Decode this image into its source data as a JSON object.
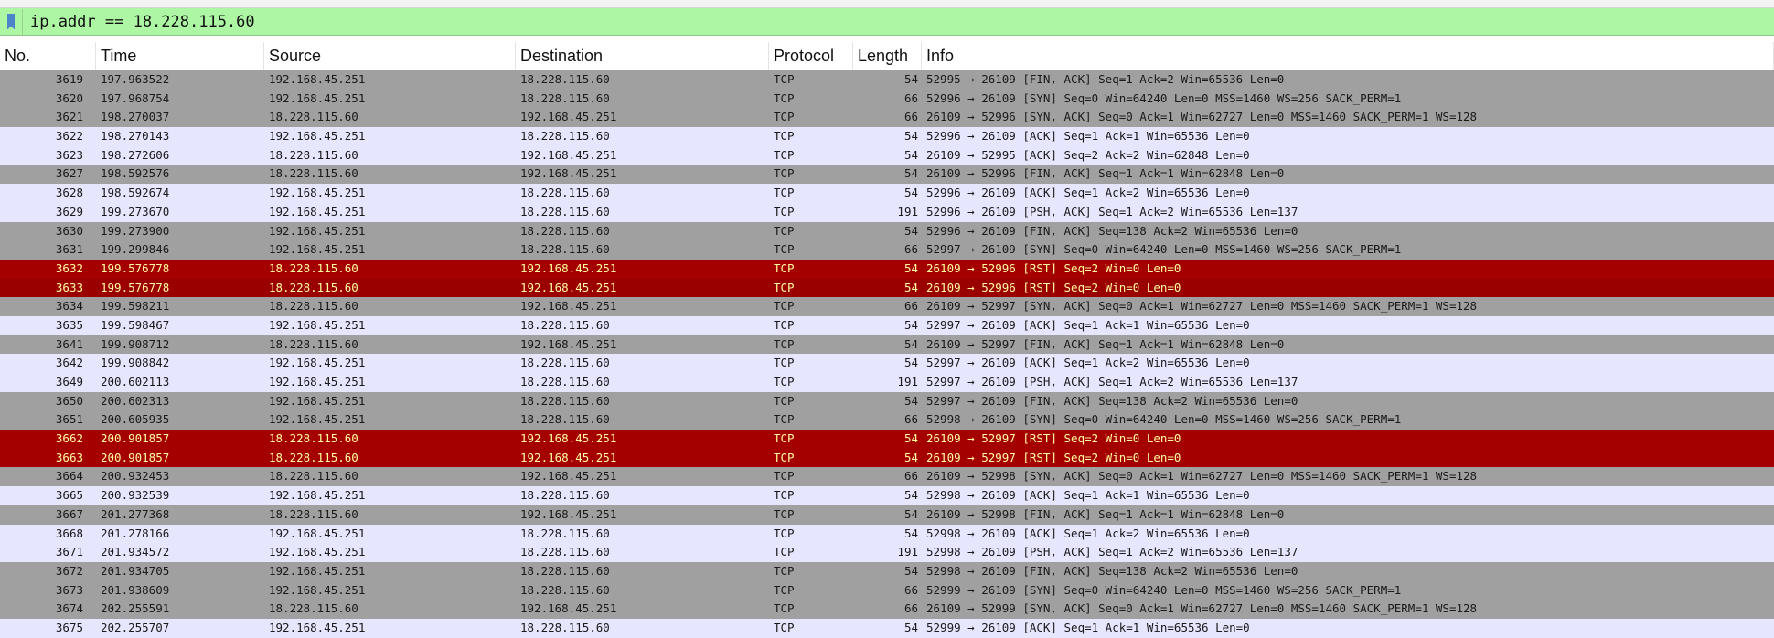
{
  "filter": {
    "value": "ip.addr == 18.228.115.60"
  },
  "columns": [
    "No.",
    "Time",
    "Source",
    "Destination",
    "Protocol",
    "Length",
    "Info"
  ],
  "colors": {
    "filter_valid": "#adf6a4",
    "row_gray": "#a0a0a0",
    "row_light": "#e7e6ff",
    "row_rst": "#a40000",
    "rst_text": "#fffc9c"
  },
  "packets": [
    {
      "no": "3619",
      "time": "197.963522",
      "src": "192.168.45.251",
      "dst": "18.228.115.60",
      "proto": "TCP",
      "len": "54",
      "info": "52995 → 26109 [FIN, ACK] Seq=1 Ack=2 Win=65536 Len=0",
      "style": "gray"
    },
    {
      "no": "3620",
      "time": "197.968754",
      "src": "192.168.45.251",
      "dst": "18.228.115.60",
      "proto": "TCP",
      "len": "66",
      "info": "52996 → 26109 [SYN] Seq=0 Win=64240 Len=0 MSS=1460 WS=256 SACK_PERM=1",
      "style": "gray"
    },
    {
      "no": "3621",
      "time": "198.270037",
      "src": "18.228.115.60",
      "dst": "192.168.45.251",
      "proto": "TCP",
      "len": "66",
      "info": "26109 → 52996 [SYN, ACK] Seq=0 Ack=1 Win=62727 Len=0 MSS=1460 SACK_PERM=1 WS=128",
      "style": "gray"
    },
    {
      "no": "3622",
      "time": "198.270143",
      "src": "192.168.45.251",
      "dst": "18.228.115.60",
      "proto": "TCP",
      "len": "54",
      "info": "52996 → 26109 [ACK] Seq=1 Ack=1 Win=65536 Len=0",
      "style": "light"
    },
    {
      "no": "3623",
      "time": "198.272606",
      "src": "18.228.115.60",
      "dst": "192.168.45.251",
      "proto": "TCP",
      "len": "54",
      "info": "26109 → 52995 [ACK] Seq=2 Ack=2 Win=62848 Len=0",
      "style": "light"
    },
    {
      "no": "3627",
      "time": "198.592576",
      "src": "18.228.115.60",
      "dst": "192.168.45.251",
      "proto": "TCP",
      "len": "54",
      "info": "26109 → 52996 [FIN, ACK] Seq=1 Ack=1 Win=62848 Len=0",
      "style": "gray"
    },
    {
      "no": "3628",
      "time": "198.592674",
      "src": "192.168.45.251",
      "dst": "18.228.115.60",
      "proto": "TCP",
      "len": "54",
      "info": "52996 → 26109 [ACK] Seq=1 Ack=2 Win=65536 Len=0",
      "style": "light"
    },
    {
      "no": "3629",
      "time": "199.273670",
      "src": "192.168.45.251",
      "dst": "18.228.115.60",
      "proto": "TCP",
      "len": "191",
      "info": "52996 → 26109 [PSH, ACK] Seq=1 Ack=2 Win=65536 Len=137",
      "style": "light"
    },
    {
      "no": "3630",
      "time": "199.273900",
      "src": "192.168.45.251",
      "dst": "18.228.115.60",
      "proto": "TCP",
      "len": "54",
      "info": "52996 → 26109 [FIN, ACK] Seq=138 Ack=2 Win=65536 Len=0",
      "style": "gray"
    },
    {
      "no": "3631",
      "time": "199.299846",
      "src": "192.168.45.251",
      "dst": "18.228.115.60",
      "proto": "TCP",
      "len": "66",
      "info": "52997 → 26109 [SYN] Seq=0 Win=64240 Len=0 MSS=1460 WS=256 SACK_PERM=1",
      "style": "gray"
    },
    {
      "no": "3632",
      "time": "199.576778",
      "src": "18.228.115.60",
      "dst": "192.168.45.251",
      "proto": "TCP",
      "len": "54",
      "info": "26109 → 52996 [RST] Seq=2 Win=0 Len=0",
      "style": "rst"
    },
    {
      "no": "3633",
      "time": "199.576778",
      "src": "18.228.115.60",
      "dst": "192.168.45.251",
      "proto": "TCP",
      "len": "54",
      "info": "26109 → 52996 [RST] Seq=2 Win=0 Len=0",
      "style": "rst2"
    },
    {
      "no": "3634",
      "time": "199.598211",
      "src": "18.228.115.60",
      "dst": "192.168.45.251",
      "proto": "TCP",
      "len": "66",
      "info": "26109 → 52997 [SYN, ACK] Seq=0 Ack=1 Win=62727 Len=0 MSS=1460 SACK_PERM=1 WS=128",
      "style": "gray"
    },
    {
      "no": "3635",
      "time": "199.598467",
      "src": "192.168.45.251",
      "dst": "18.228.115.60",
      "proto": "TCP",
      "len": "54",
      "info": "52997 → 26109 [ACK] Seq=1 Ack=1 Win=65536 Len=0",
      "style": "light"
    },
    {
      "no": "3641",
      "time": "199.908712",
      "src": "18.228.115.60",
      "dst": "192.168.45.251",
      "proto": "TCP",
      "len": "54",
      "info": "26109 → 52997 [FIN, ACK] Seq=1 Ack=1 Win=62848 Len=0",
      "style": "gray"
    },
    {
      "no": "3642",
      "time": "199.908842",
      "src": "192.168.45.251",
      "dst": "18.228.115.60",
      "proto": "TCP",
      "len": "54",
      "info": "52997 → 26109 [ACK] Seq=1 Ack=2 Win=65536 Len=0",
      "style": "light"
    },
    {
      "no": "3649",
      "time": "200.602113",
      "src": "192.168.45.251",
      "dst": "18.228.115.60",
      "proto": "TCP",
      "len": "191",
      "info": "52997 → 26109 [PSH, ACK] Seq=1 Ack=2 Win=65536 Len=137",
      "style": "light"
    },
    {
      "no": "3650",
      "time": "200.602313",
      "src": "192.168.45.251",
      "dst": "18.228.115.60",
      "proto": "TCP",
      "len": "54",
      "info": "52997 → 26109 [FIN, ACK] Seq=138 Ack=2 Win=65536 Len=0",
      "style": "gray"
    },
    {
      "no": "3651",
      "time": "200.605935",
      "src": "192.168.45.251",
      "dst": "18.228.115.60",
      "proto": "TCP",
      "len": "66",
      "info": "52998 → 26109 [SYN] Seq=0 Win=64240 Len=0 MSS=1460 WS=256 SACK_PERM=1",
      "style": "gray"
    },
    {
      "no": "3662",
      "time": "200.901857",
      "src": "18.228.115.60",
      "dst": "192.168.45.251",
      "proto": "TCP",
      "len": "54",
      "info": "26109 → 52997 [RST] Seq=2 Win=0 Len=0",
      "style": "rst"
    },
    {
      "no": "3663",
      "time": "200.901857",
      "src": "18.228.115.60",
      "dst": "192.168.45.251",
      "proto": "TCP",
      "len": "54",
      "info": "26109 → 52997 [RST] Seq=2 Win=0 Len=0",
      "style": "rst"
    },
    {
      "no": "3664",
      "time": "200.932453",
      "src": "18.228.115.60",
      "dst": "192.168.45.251",
      "proto": "TCP",
      "len": "66",
      "info": "26109 → 52998 [SYN, ACK] Seq=0 Ack=1 Win=62727 Len=0 MSS=1460 SACK_PERM=1 WS=128",
      "style": "gray"
    },
    {
      "no": "3665",
      "time": "200.932539",
      "src": "192.168.45.251",
      "dst": "18.228.115.60",
      "proto": "TCP",
      "len": "54",
      "info": "52998 → 26109 [ACK] Seq=1 Ack=1 Win=65536 Len=0",
      "style": "light"
    },
    {
      "no": "3667",
      "time": "201.277368",
      "src": "18.228.115.60",
      "dst": "192.168.45.251",
      "proto": "TCP",
      "len": "54",
      "info": "26109 → 52998 [FIN, ACK] Seq=1 Ack=1 Win=62848 Len=0",
      "style": "gray"
    },
    {
      "no": "3668",
      "time": "201.278166",
      "src": "192.168.45.251",
      "dst": "18.228.115.60",
      "proto": "TCP",
      "len": "54",
      "info": "52998 → 26109 [ACK] Seq=1 Ack=2 Win=65536 Len=0",
      "style": "light"
    },
    {
      "no": "3671",
      "time": "201.934572",
      "src": "192.168.45.251",
      "dst": "18.228.115.60",
      "proto": "TCP",
      "len": "191",
      "info": "52998 → 26109 [PSH, ACK] Seq=1 Ack=2 Win=65536 Len=137",
      "style": "light"
    },
    {
      "no": "3672",
      "time": "201.934705",
      "src": "192.168.45.251",
      "dst": "18.228.115.60",
      "proto": "TCP",
      "len": "54",
      "info": "52998 → 26109 [FIN, ACK] Seq=138 Ack=2 Win=65536 Len=0",
      "style": "gray"
    },
    {
      "no": "3673",
      "time": "201.938609",
      "src": "192.168.45.251",
      "dst": "18.228.115.60",
      "proto": "TCP",
      "len": "66",
      "info": "52999 → 26109 [SYN] Seq=0 Win=64240 Len=0 MSS=1460 WS=256 SACK_PERM=1",
      "style": "gray"
    },
    {
      "no": "3674",
      "time": "202.255591",
      "src": "18.228.115.60",
      "dst": "192.168.45.251",
      "proto": "TCP",
      "len": "66",
      "info": "26109 → 52999 [SYN, ACK] Seq=0 Ack=1 Win=62727 Len=0 MSS=1460 SACK_PERM=1 WS=128",
      "style": "gray"
    },
    {
      "no": "3675",
      "time": "202.255707",
      "src": "192.168.45.251",
      "dst": "18.228.115.60",
      "proto": "TCP",
      "len": "54",
      "info": "52999 → 26109 [ACK] Seq=1 Ack=1 Win=65536 Len=0",
      "style": "light"
    }
  ]
}
